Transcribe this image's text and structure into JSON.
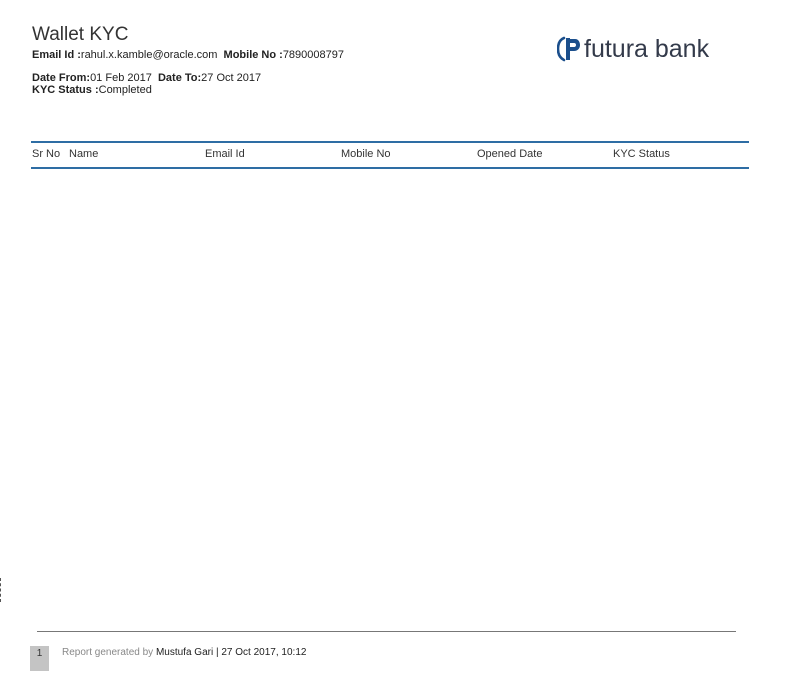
{
  "report": {
    "title": "Wallet KYC",
    "email_label": "Email Id :",
    "email_value": "rahul.x.kamble@oracle.com",
    "mobile_label": "Mobile No :",
    "mobile_value": "7890008797",
    "date_from_label": "Date From:",
    "date_from_value": "01 Feb 2017",
    "date_to_label": "Date To:",
    "date_to_value": "27 Oct 2017",
    "kyc_status_label": "KYC Status :",
    "kyc_status_value": "Completed"
  },
  "brand": {
    "logo_text": "futura bank",
    "logo_icon": "futura-logo-icon",
    "accent_color": "#2e6da4"
  },
  "table": {
    "columns": [
      "Sr No",
      "Name",
      "Email Id",
      "Mobile No",
      "Opened Date",
      "KYC Status"
    ],
    "rows": []
  },
  "footer": {
    "page_number": "1",
    "generated_by_label": "Report generated by",
    "user": "Mustufa Gari",
    "separator": "|",
    "timestamp": "27 Oct 2017, 10:12"
  }
}
